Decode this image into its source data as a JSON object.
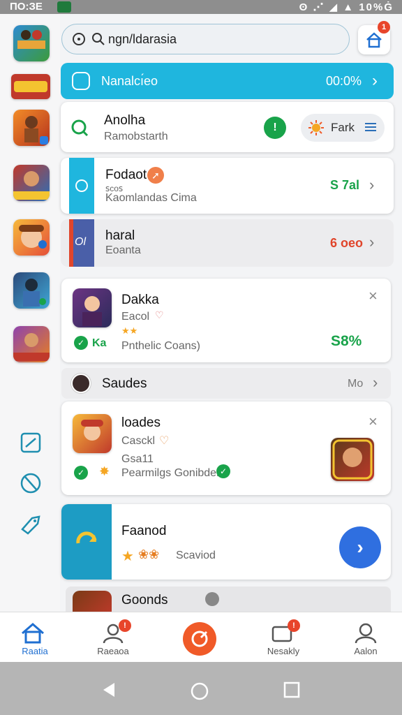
{
  "status_bar": {
    "time": "ПО:ЗЕ",
    "right": "ʘ ⋰ ◢ ▲ 10%Ġ"
  },
  "top_bar": {
    "search_value": "ngn/ldarasia",
    "home_badge": "1"
  },
  "banner": {
    "label": "Nanalcı́eo",
    "value": "00:0%"
  },
  "cards": {
    "anolha": {
      "title": "Anolha",
      "subtitle": "Ramobstarth",
      "info_badge": "!",
      "chip_label": "Fark"
    },
    "fodaot": {
      "title": "Fodaot",
      "meta": "ꜱᴄᴏꜱ",
      "subtitle": "Kaomlandas Cima",
      "price": "S 7al"
    },
    "haral": {
      "title": "haral",
      "subtitle": "Eoanta",
      "tag": "Ol",
      "price": "6 oeo"
    },
    "dakka": {
      "title": "Dakka",
      "subtitle": "Eacol",
      "rating": "★★",
      "note_prefix": "Ka",
      "note": "Pnthelic Coans)",
      "percent": "S8%"
    },
    "saudes": {
      "title": "Saudes",
      "more": "Mo"
    },
    "loades": {
      "title": "loades",
      "subtitle": "Casckl",
      "meta": "Gsa11",
      "note": "Pearmilgs Gonibden"
    },
    "faanod": {
      "title": "Faanod",
      "note": "Scaviod"
    },
    "goonds": {
      "title": "Goonds"
    }
  },
  "bottom_nav": [
    {
      "label": "Raatia",
      "badge": ""
    },
    {
      "label": "Raeaoa",
      "badge": "!"
    },
    {
      "label": "",
      "badge": ""
    },
    {
      "label": "Nesakly",
      "badge": "!"
    },
    {
      "label": "Aalon",
      "badge": ""
    }
  ],
  "colors": {
    "accent": "#1fb6de",
    "green": "#19a34a",
    "orange": "#f05a28",
    "blue": "#2f6fe0"
  },
  "icons": [
    "search-icon",
    "home-icon",
    "chevron-right-icon",
    "close-icon",
    "star-icon",
    "check-icon",
    "back-icon",
    "home-circle-icon",
    "recents-icon"
  ]
}
